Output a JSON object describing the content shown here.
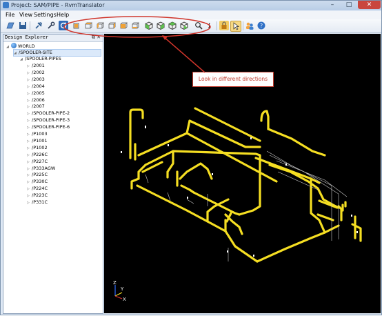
{
  "window": {
    "title": "Project: SAM/PIPE - RvmTranslator"
  },
  "menu": [
    "File",
    "View",
    "Settings",
    "Help"
  ],
  "panel": {
    "title": "Design Explorer"
  },
  "tree": {
    "root": "WORLD",
    "site": "/SPOOLER-SITE",
    "zone": "/SPOOLER-PIPES",
    "items": [
      "/2001",
      "/2002",
      "/2003",
      "/2004",
      "/2005",
      "/2006",
      "/2007",
      "/SPOOLER-PIPE-2",
      "/SPOOLER-PIPE-3",
      "/SPOOLER-PIPE-6",
      "/P1003",
      "/P1001",
      "/P1002",
      "/P226C",
      "/P227C",
      "/P333AGW",
      "/P225C",
      "/P330C",
      "/P224C",
      "/P223C",
      "/P331C"
    ]
  },
  "callout": {
    "text": "Look in different directions"
  },
  "viewport": {
    "axes": {
      "x": "X",
      "y": "Y",
      "z": "Z"
    }
  },
  "colors": {
    "pipe": "#f5de22",
    "annotation": "#d0352b",
    "viewport_bg": "#000000"
  },
  "toolbar_icons": [
    "open-icon",
    "save-icon",
    "pin-icon",
    "wrench-icon",
    "refresh-icon",
    "view-front-icon",
    "view-back-icon",
    "view-left-icon",
    "view-right-icon",
    "view-top-icon",
    "view-bottom-icon",
    "iso-view-1-icon",
    "iso-view-2-icon",
    "iso-view-3-icon",
    "iso-view-4-icon",
    "zoom-icon",
    "rotate-icon",
    "lock-icon",
    "select-icon",
    "users-icon",
    "help-icon"
  ]
}
